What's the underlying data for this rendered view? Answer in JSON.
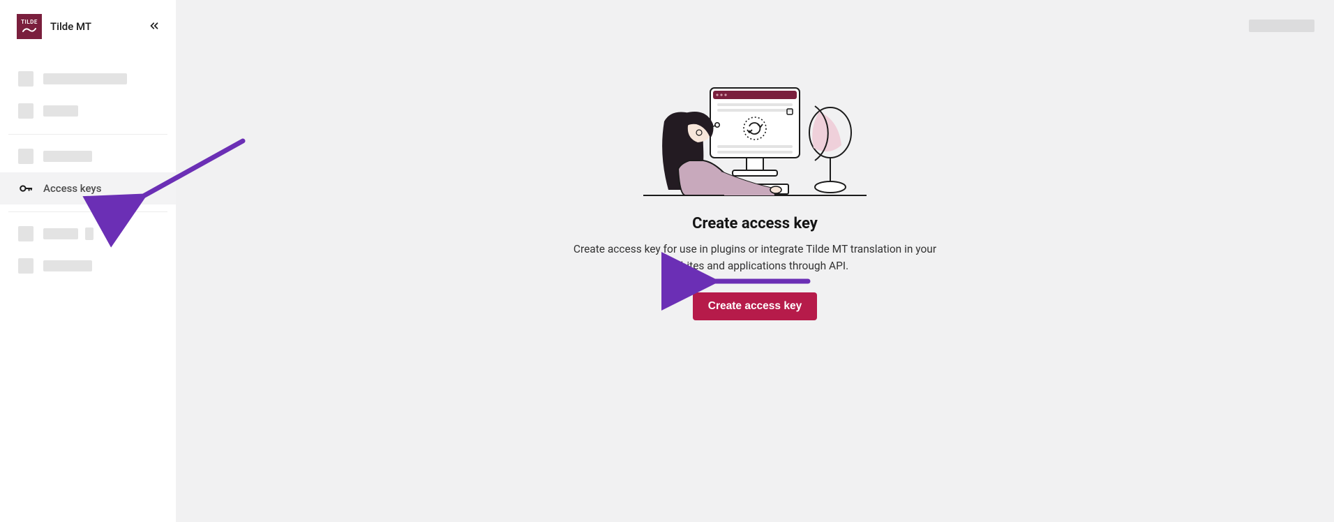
{
  "app": {
    "name": "Tilde MT"
  },
  "sidebar": {
    "access_keys_label": "Access keys"
  },
  "main": {
    "heading": "Create access key",
    "subtext": "Create access key for use in plugins or integrate Tilde MT translation in your wesbites and applications through API.",
    "cta_label": "Create access key"
  },
  "colors": {
    "brand_dark": "#7a1f3d",
    "accent": "#b61b4a",
    "arrow": "#6b2fb5"
  }
}
